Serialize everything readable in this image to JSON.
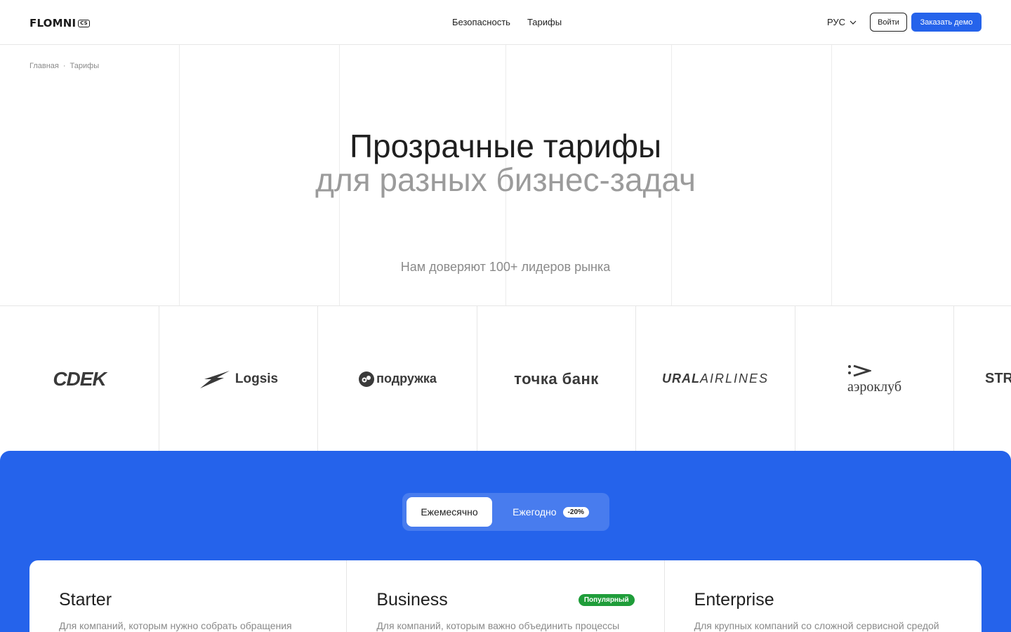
{
  "header": {
    "logo": "FLOMNI",
    "logo_badge": "CS",
    "nav": [
      "Безопасность",
      "Тарифы"
    ],
    "language": "РУС",
    "login": "Войти",
    "demo": "Заказать демо"
  },
  "breadcrumb": {
    "home": "Главная",
    "separator": "·",
    "current": "Тарифы"
  },
  "hero": {
    "title": "Прозрачные тарифы",
    "subtitle": "для разных бизнес-задач",
    "trust": "Нам доверяют 100+ лидеров рынка"
  },
  "clients": {
    "cdek": "CDEK",
    "logsis": "Logsis",
    "podruzhka": "подружка",
    "tochka": "точка банк",
    "ural_bold": "URAL",
    "ural_light": "AIRLINES",
    "aeroclub": "аэроклуб",
    "partial": "STR"
  },
  "billing": {
    "monthly": "Ежемесячно",
    "yearly": "Ежегодно",
    "discount": "-20%"
  },
  "plans": [
    {
      "name": "Starter",
      "description": "Для компаний, которым нужно собрать обращения",
      "badge": ""
    },
    {
      "name": "Business",
      "description": "Для компаний, которым важно объединить процессы",
      "badge": "Популярный"
    },
    {
      "name": "Enterprise",
      "description": "Для крупных компаний со сложной сервисной средой",
      "badge": ""
    }
  ],
  "colors": {
    "accent": "#2563eb",
    "popular": "#1f9d3a"
  }
}
